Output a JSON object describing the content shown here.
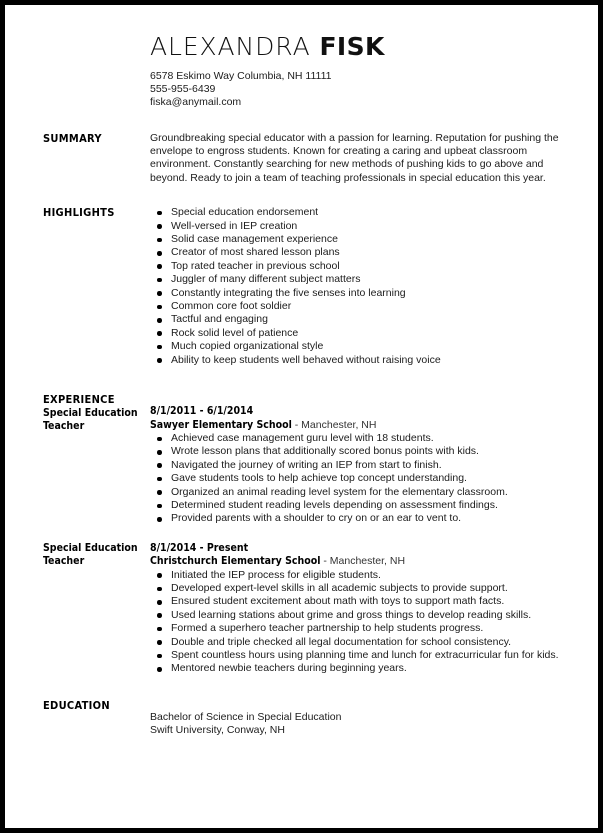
{
  "header": {
    "first_name": "ALEXANDRA",
    "last_name": "FISK",
    "address": "6578 Eskimo Way Columbia, NH 11111",
    "phone": "555-955-6439",
    "email": "fiska@anymail.com"
  },
  "summary": {
    "title": "SUMMARY",
    "text": "Groundbreaking special educator with a passion for learning. Reputation for pushing the envelope to engross students. Known for creating a caring and upbeat classroom environment. Constantly searching for new methods of pushing kids to go above and beyond. Ready to join a team of teaching professionals in special education this year."
  },
  "highlights": {
    "title": "HIGHLIGHTS",
    "items": [
      "Special education endorsement",
      "Well-versed in IEP creation",
      "Solid case management experience",
      "Creator of most shared lesson plans",
      "Top rated teacher in previous school",
      "Juggler of many different subject matters",
      "Constantly integrating the five senses into learning",
      "Common core foot soldier",
      "Tactful and engaging",
      "Rock solid level of patience",
      "Much copied organizational style",
      "Ability to keep students well behaved without raising voice"
    ]
  },
  "experience": {
    "title": "EXPERIENCE",
    "jobs": [
      {
        "title_line1": "Special Education",
        "title_line2": "Teacher",
        "dates": "8/1/2011 - 6/1/2014",
        "company": "Sawyer Elementary School",
        "location": " - Manchester, NH",
        "bullets": [
          "Achieved case management guru level with 18 students.",
          "Wrote lesson plans that additionally scored bonus points with kids.",
          "Navigated the journey of writing an IEP from start to finish.",
          "Gave students tools to help achieve top concept understanding.",
          "Organized an animal reading level system for the elementary classroom.",
          "Determined student reading levels depending on assessment findings.",
          "Provided parents with a shoulder to cry on or an ear to vent to."
        ]
      },
      {
        "title_line1": "Special Education",
        "title_line2": "Teacher",
        "dates": "8/1/2014 - Present",
        "company": "Christchurch Elementary School",
        "location": " - Manchester, NH",
        "bullets": [
          "Initiated the IEP process for eligible students.",
          "Developed expert-level skills in all academic subjects to provide support.",
          "Ensured student excitement about math with toys to support math facts.",
          "Used learning stations about grime and gross things to develop reading skills.",
          "Formed a superhero teacher partnership to help students progress.",
          "Double and triple checked all legal documentation for school consistency.",
          "Spent countless hours using planning time and lunch for extracurricular fun for kids.",
          "Mentored newbie teachers during beginning years."
        ]
      }
    ]
  },
  "education": {
    "title": "EDUCATION",
    "degree": "Bachelor of Science in Special Education",
    "school": "Swift University, Conway, NH"
  },
  "colors": {
    "page_border": "#000000",
    "text": "#1c1c1c",
    "heading": "#000000",
    "background": "#ffffff"
  }
}
